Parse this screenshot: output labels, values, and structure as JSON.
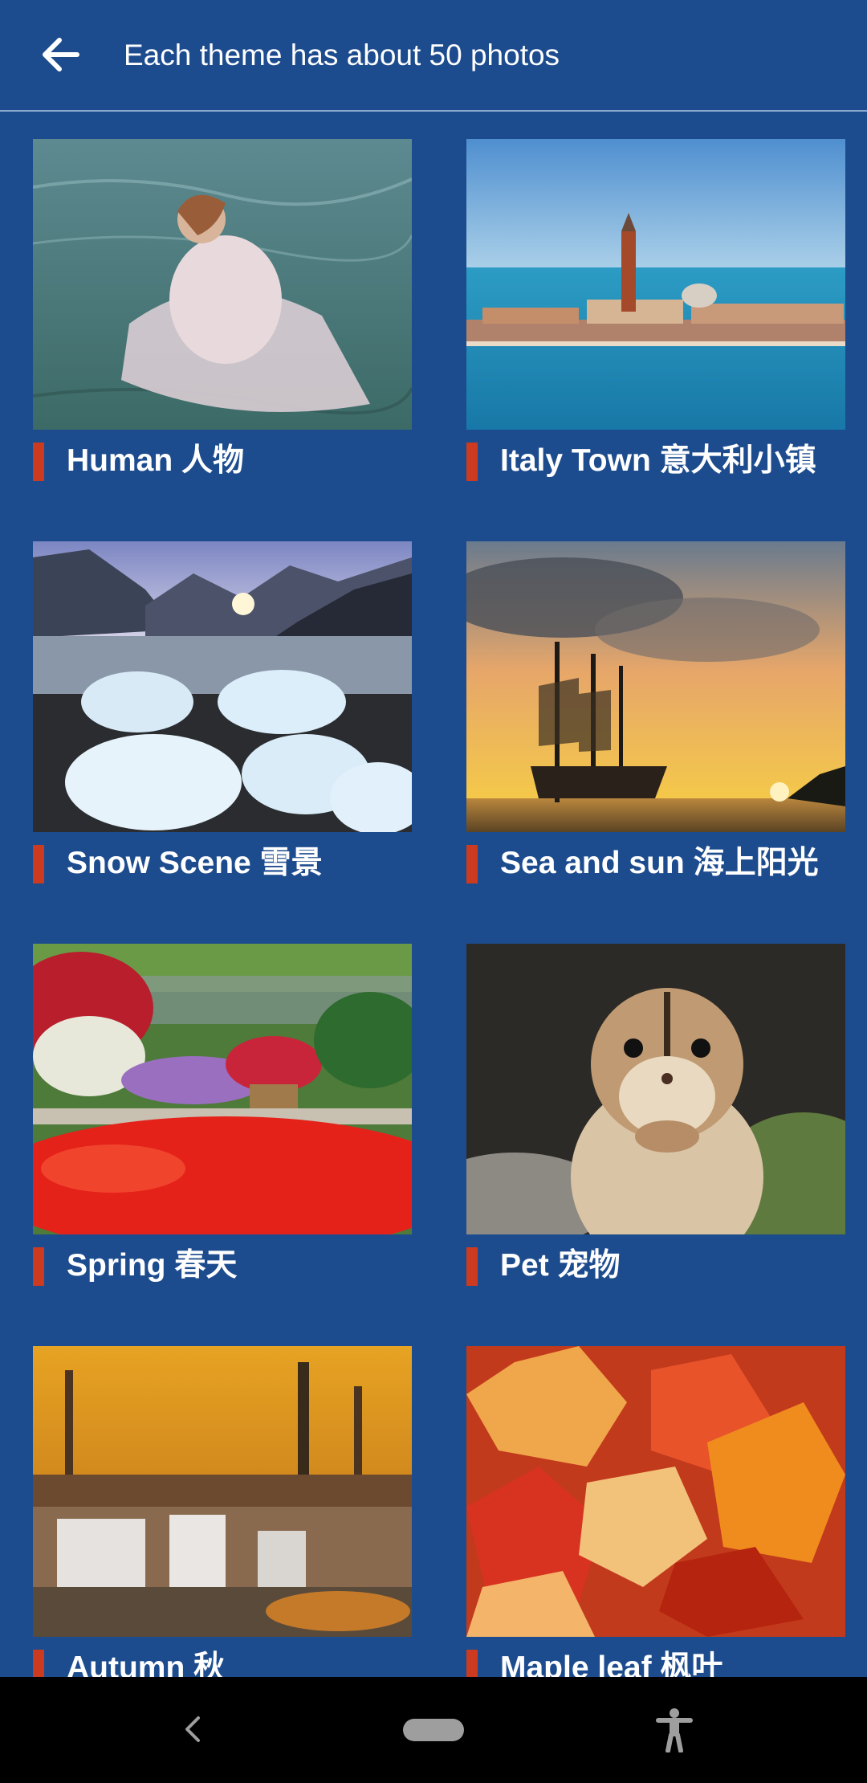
{
  "header": {
    "title": "Each theme has about 50 photos",
    "back_icon": "arrow-left-icon"
  },
  "themes": [
    {
      "label": "Human 人物"
    },
    {
      "label": "Italy Town 意大利小镇"
    },
    {
      "label": "Snow Scene 雪景"
    },
    {
      "label": "Sea and sun 海上阳光"
    },
    {
      "label": "Spring 春天"
    },
    {
      "label": "Pet 宠物"
    },
    {
      "label": "Autumn 秋"
    },
    {
      "label": "Maple leaf 枫叶"
    }
  ],
  "navbar": {
    "back_icon": "chevron-left-icon",
    "home_icon": "home-pill-icon",
    "accessibility_icon": "accessibility-icon"
  },
  "colors": {
    "background": "#1d4c8e",
    "accent": "#cc3a20",
    "text": "#ffffff",
    "navbar": "#000000"
  }
}
